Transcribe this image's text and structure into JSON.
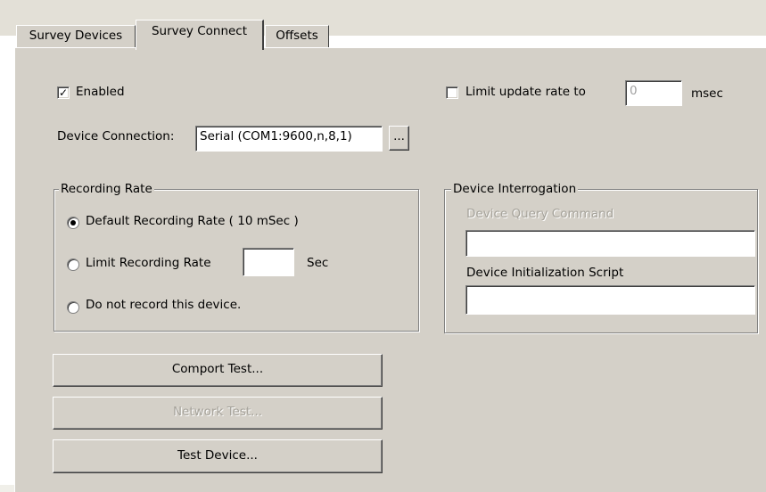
{
  "tabs": [
    {
      "label": "Survey Devices"
    },
    {
      "label": "Survey Connect"
    },
    {
      "label": "Offsets"
    }
  ],
  "enabled": {
    "label": "Enabled",
    "checked": true
  },
  "limit_update": {
    "label": "Limit update rate to",
    "checked": false,
    "value": "0",
    "unit": "msec"
  },
  "device_connection": {
    "label": "Device Connection:",
    "value": "Serial (COM1:9600,n,8,1)",
    "browse_label": "..."
  },
  "recording_rate": {
    "title": "Recording Rate",
    "default_label": "Default Recording Rate ( 10 mSec )",
    "limit_label": "Limit Recording Rate",
    "limit_value": "",
    "limit_unit": "Sec",
    "none_label": "Do not record this device.",
    "selected": "default"
  },
  "device_interrogation": {
    "title": "Device Interrogation",
    "query_label": "Device Query Command",
    "query_value": "",
    "init_label": "Device Initialization Script",
    "init_value": ""
  },
  "buttons": {
    "comport_test": "Comport Test...",
    "network_test": "Network Test...",
    "test_device": "Test Device..."
  }
}
